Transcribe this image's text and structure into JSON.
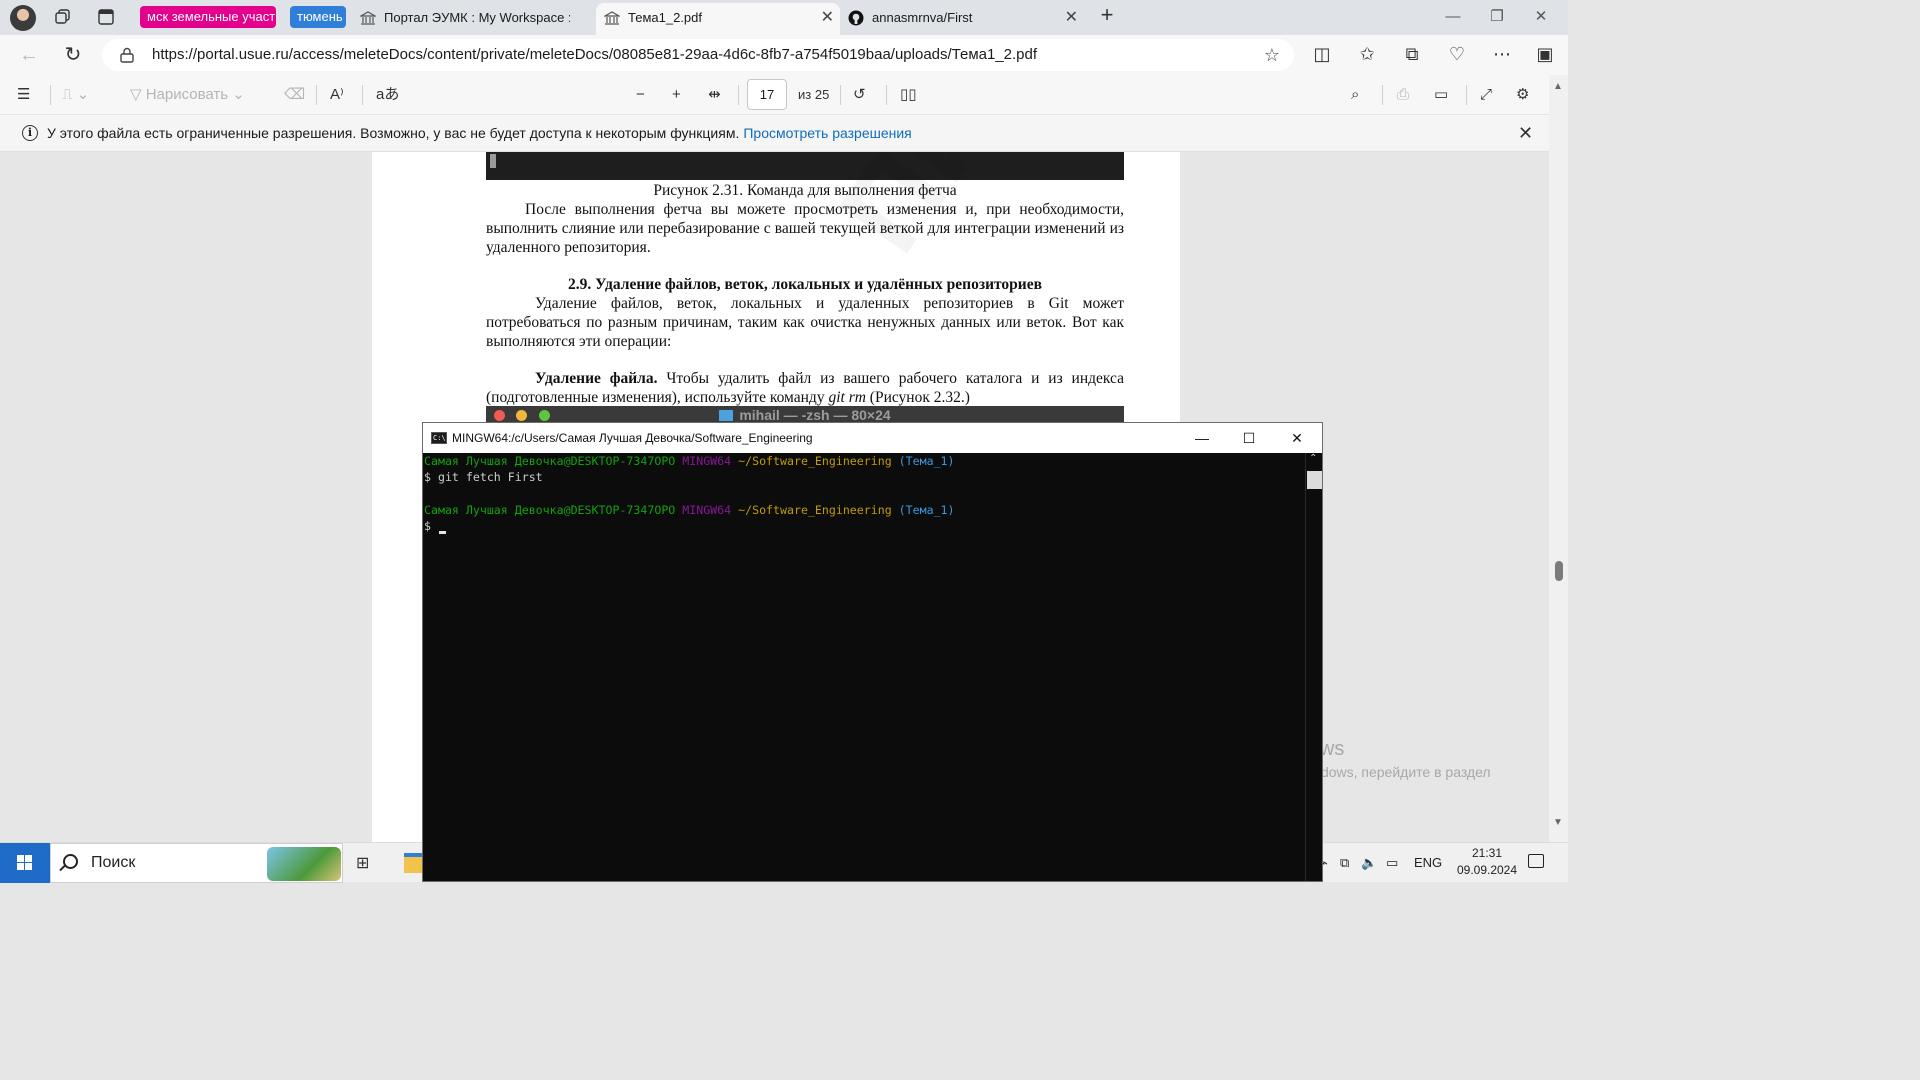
{
  "browser": {
    "tab_groups": [
      {
        "label": "мск земельные участ",
        "color": "#e3008c"
      },
      {
        "label": "тюмень",
        "color": "#2f7ed8"
      }
    ],
    "tabs": [
      {
        "label": "Портал ЭУМК : My Workspace : Д",
        "icon": "bank-icon",
        "active": false
      },
      {
        "label": "Тема1_2.pdf",
        "icon": "bank-icon",
        "active": true
      },
      {
        "label": "annasmrnva/First",
        "icon": "github-icon",
        "active": false
      }
    ],
    "url": "https://portal.usue.ru/access/meleteDocs/content/private/meleteDocs/08085e81-29aa-4d6c-8fb7-a754f5019baa/uploads/Тема1_2.pdf"
  },
  "pdf_toolbar": {
    "draw_label": "Нарисовать",
    "page_current": "17",
    "page_total": "из 25"
  },
  "infobar": {
    "text": "У этого файла есть ограниченные разрешения. Возможно, у вас не будет доступа к некоторым функциям.",
    "link": "Просмотреть разрешения"
  },
  "document": {
    "figure_caption": "Рисунок 2.31. Команда для выполнения фетча",
    "paragraph1": "После выполнения фетча вы можете просмотреть изменения и, при необходимости, выполнить слияние или перебазирование с вашей текущей веткой для интеграции изменений из удаленного репозитория.",
    "section_title": "2.9. Удаление файлов, веток, локальных и удалённых репозиториев",
    "paragraph2": "Удаление файлов, веток, локальных и удаленных репозиториев в Git может потребоваться по разным причинам, таким как очистка ненужных данных или веток. Вот как выполняются эти операции:",
    "para3_bold": "Удаление файла.",
    "para3_text": " Чтобы удалить файл из вашего рабочего каталога и из индекса (подготовленные изменения), используйте команду ",
    "para3_cmd": "git rm",
    "para3_tail": " (Рисунок 2.32.)",
    "mac_window_title": "mihail — -zsh — 80×24",
    "watermark": "Пинов"
  },
  "terminal": {
    "title": "MINGW64:/c/Users/Самая Лучшая Девочка/Software_Engineering",
    "prompt_user": "Самая Лучшая Девочка@DESKTOP-7347OPO",
    "prompt_env": "MINGW64",
    "prompt_path": "~/Software_Engineering",
    "prompt_branch": "(Тема_1)",
    "command1": "$ git fetch First",
    "prompt_symbol": "$"
  },
  "activation": {
    "title": "Активация Windows",
    "subtitle": "Чтобы активировать Windows, перейдите в раздел \"Параметры\"."
  },
  "taskbar": {
    "search_placeholder": "Поиск",
    "lang": "ENG",
    "time": "21:31",
    "date": "09.09.2024"
  }
}
